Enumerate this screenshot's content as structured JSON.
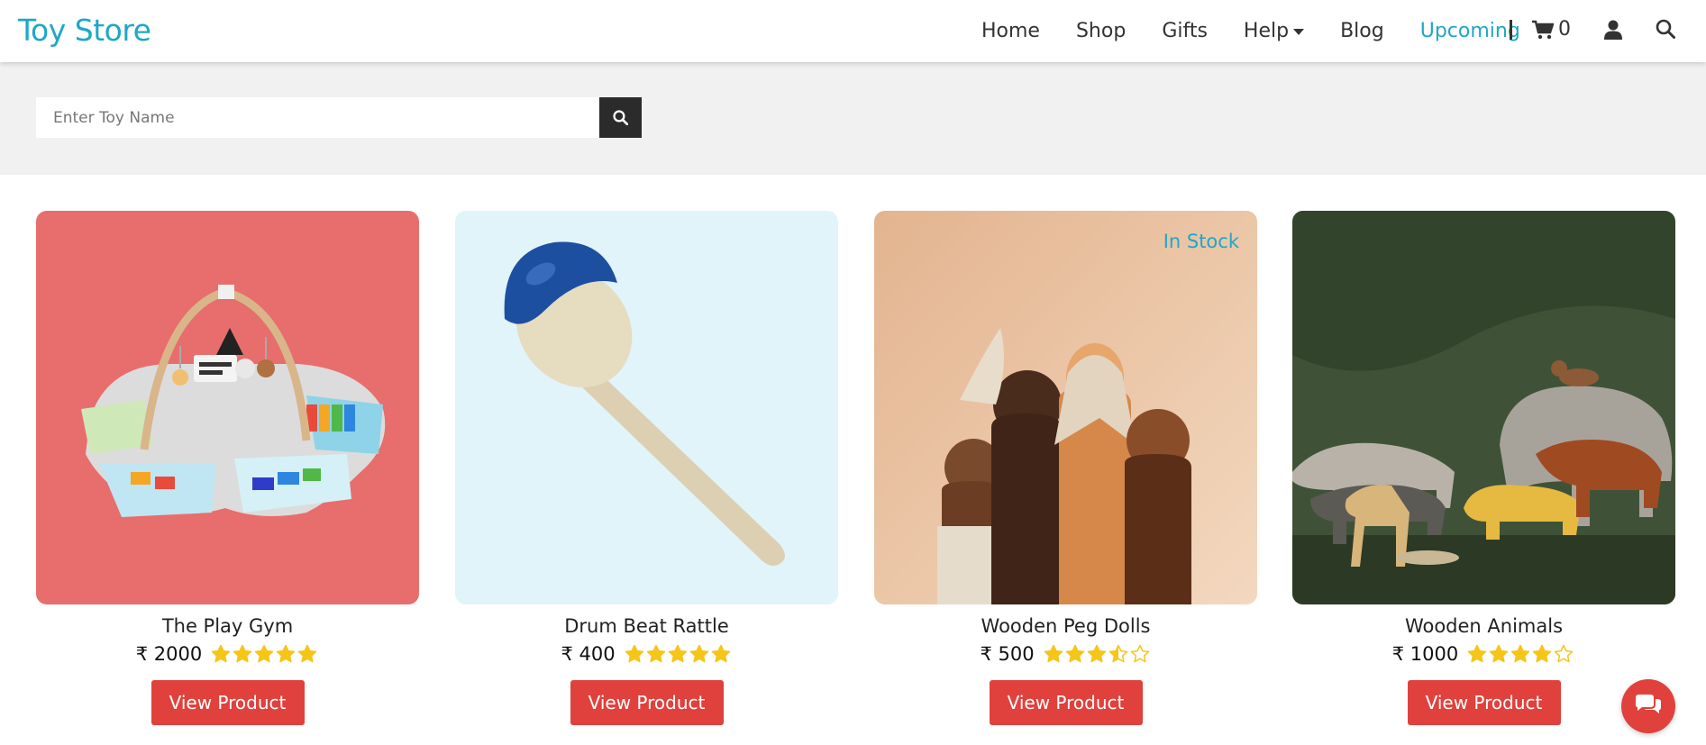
{
  "header": {
    "brand": "Toy Store",
    "nav": {
      "home": "Home",
      "shop": "Shop",
      "gifts": "Gifts",
      "help": "Help",
      "blog": "Blog",
      "upcoming": "Upcoming"
    },
    "cart_count": "0",
    "icons": [
      "shopping-cart-icon",
      "user-icon",
      "search-icon"
    ]
  },
  "search": {
    "placeholder": "Enter Toy Name",
    "value": ""
  },
  "colors": {
    "accent": "#1fa7c6",
    "button": "#e0413d",
    "star": "#f5c518"
  },
  "products": [
    {
      "name": "The Play Gym",
      "price": "₹ 2000",
      "rating": 5,
      "button": "View Product",
      "badge": "",
      "image": "baby-play-gym-mat"
    },
    {
      "name": "Drum Beat Rattle",
      "price": "₹ 400",
      "rating": 5,
      "button": "View Product",
      "badge": "",
      "image": "wooden-maraca-rattle"
    },
    {
      "name": "Wooden Peg Dolls",
      "price": "₹ 500",
      "rating": 3.5,
      "button": "View Product",
      "badge": "In Stock",
      "image": "wooden-peg-dolls"
    },
    {
      "name": "Wooden Animals",
      "price": "₹ 1000",
      "rating": 4,
      "button": "View Product",
      "badge": "",
      "image": "wooden-animal-figures"
    }
  ],
  "chat": {
    "icon": "chat-bubbles-icon"
  }
}
